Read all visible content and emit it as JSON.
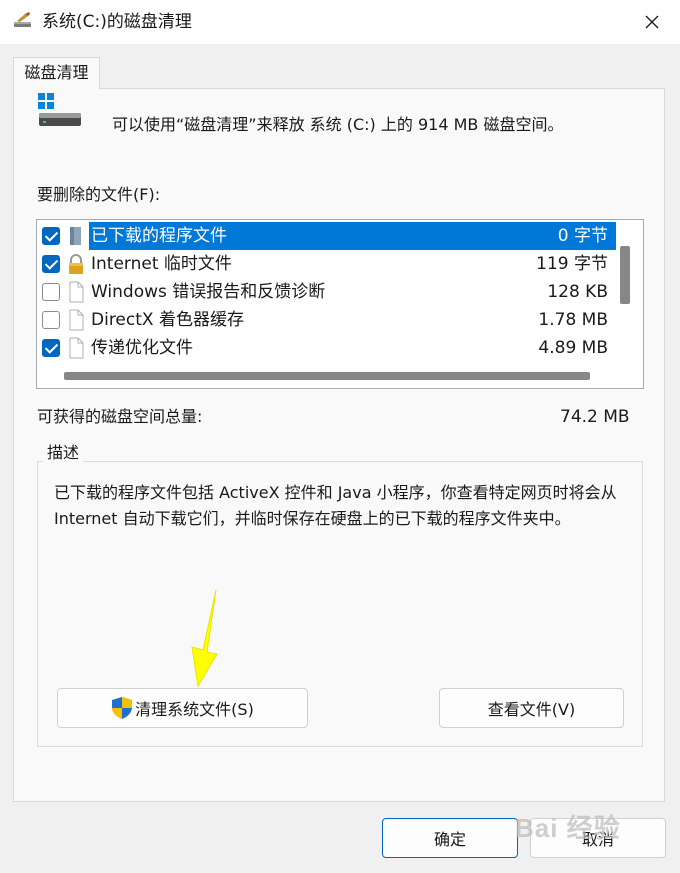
{
  "window": {
    "title": "系统(C:)的磁盘清理"
  },
  "tab": {
    "label": "磁盘清理"
  },
  "summary_text": "可以使用“磁盘清理”来释放 系统 (C:) 上的 914 MB 磁盘空间。",
  "files_label": "要删除的文件(F):",
  "files": [
    {
      "name": "已下载的程序文件",
      "size": "0 字节",
      "checked": true,
      "selected": true,
      "icon": "folder-icon"
    },
    {
      "name": "Internet 临时文件",
      "size": "119 字节",
      "checked": true,
      "selected": false,
      "icon": "lock-icon"
    },
    {
      "name": "Windows 错误报告和反馈诊断",
      "size": "128 KB",
      "checked": false,
      "selected": false,
      "icon": "file-icon"
    },
    {
      "name": "DirectX 着色器缓存",
      "size": "1.78 MB",
      "checked": false,
      "selected": false,
      "icon": "file-icon"
    },
    {
      "name": "传递优化文件",
      "size": "4.89 MB",
      "checked": true,
      "selected": false,
      "icon": "file-icon"
    }
  ],
  "total": {
    "label": "可获得的磁盘空间总量:",
    "value": "74.2 MB"
  },
  "description": {
    "title": "描述",
    "text": "已下载的程序文件包括 ActiveX 控件和 Java 小程序，你查看特定网页时将会从 Internet 自动下载它们，并临时保存在硬盘上的已下载的程序文件夹中。"
  },
  "buttons": {
    "clean_system": "清理系统文件(S)",
    "view_files": "查看文件(V)",
    "ok": "确定",
    "cancel": "取消"
  },
  "watermark": "Bai 经验",
  "colors": {
    "selection": "#0078d7",
    "checkbox": "#0067c0",
    "arrow": "#ffff00"
  }
}
